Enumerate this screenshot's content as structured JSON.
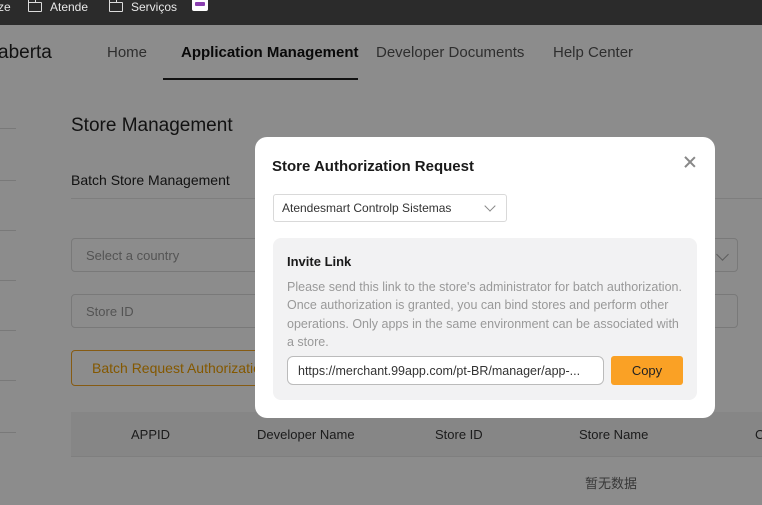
{
  "bookmarks": {
    "items": [
      {
        "label": "ze"
      },
      {
        "label": "Atende"
      },
      {
        "label": "Serviços"
      }
    ]
  },
  "header": {
    "brand": "aberta",
    "nav": [
      {
        "label": "Home"
      },
      {
        "label": "Application Management"
      },
      {
        "label": "Developer Documents"
      },
      {
        "label": "Help Center"
      }
    ],
    "active_nav": "Application Management"
  },
  "page": {
    "title": "Store Management",
    "subtitle": "Batch Store Management",
    "country_placeholder": "Select a country",
    "store_id_placeholder": "Store ID",
    "batch_button": "Batch Request Authorization",
    "table": {
      "columns": [
        "APPID",
        "Developer Name",
        "Store ID",
        "Store Name",
        "C"
      ],
      "empty_text": "暂无数据"
    }
  },
  "modal": {
    "title": "Store Authorization Request",
    "select_value": "Atendesmart Controlp Sistemas",
    "invite": {
      "title": "Invite Link",
      "description": "Please send this link to the store's administrator for batch authorization. Once authorization is granted, you can bind stores and perform other operations. Only apps in the same environment can be associated with a store.",
      "link": "https://merchant.99app.com/pt-BR/manager/app-...",
      "copy_label": "Copy"
    }
  },
  "colors": {
    "accent": "#faa125",
    "batch_text": "#f0a000"
  }
}
